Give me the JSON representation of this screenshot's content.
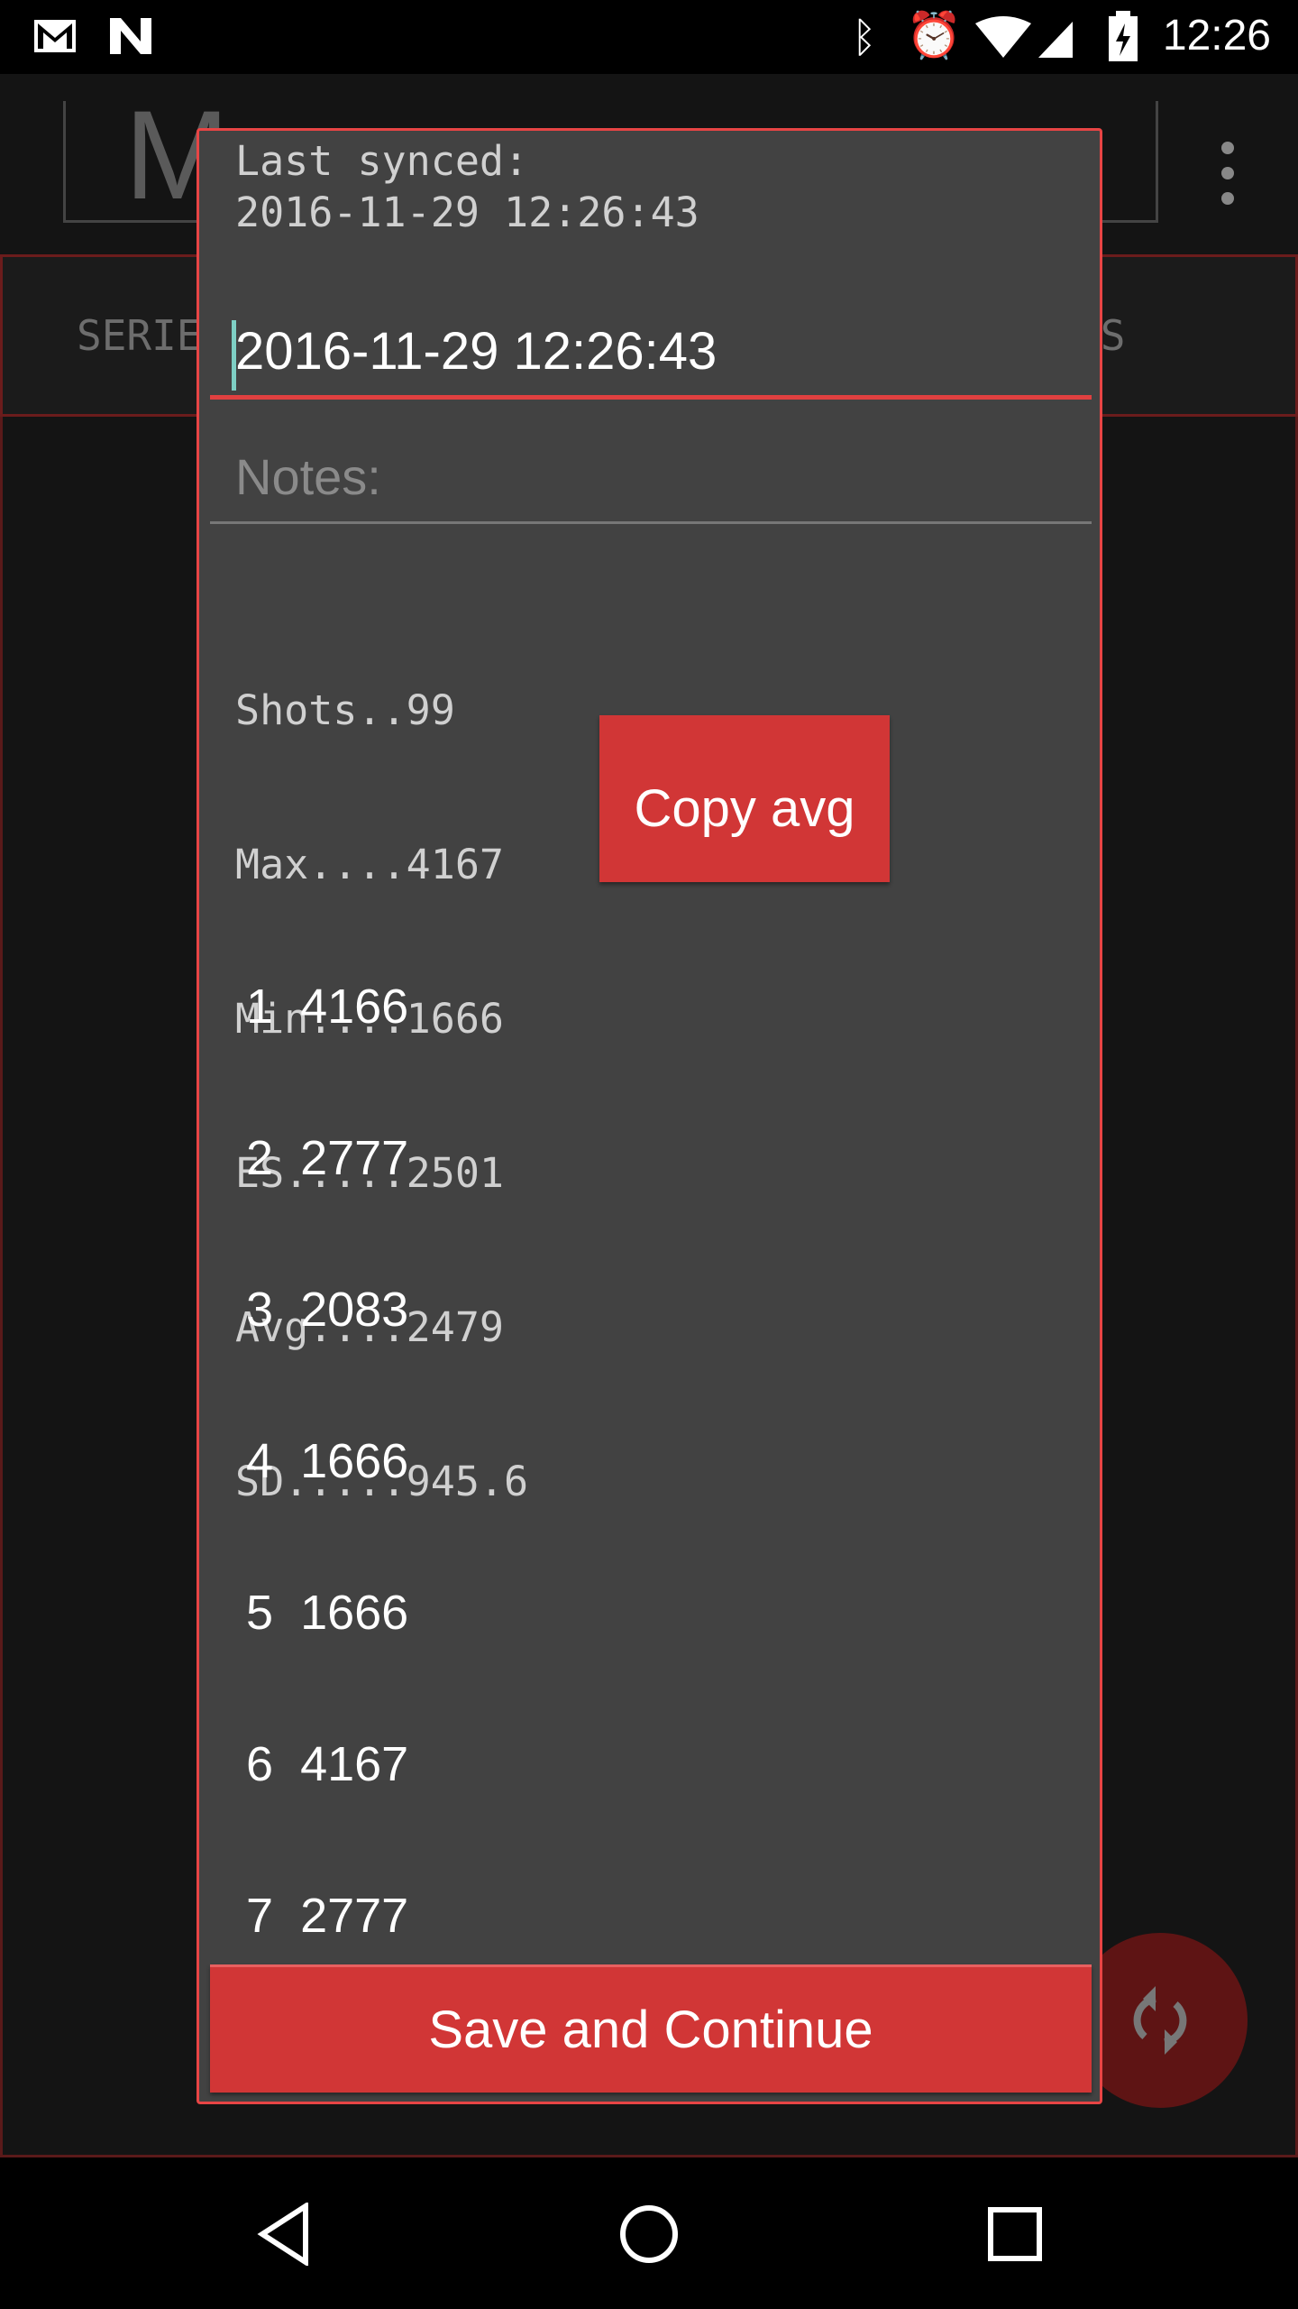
{
  "status_bar": {
    "time": "12:26",
    "icons": [
      "gmail-icon",
      "n-notification-icon",
      "bluetooth-icon",
      "alarm-icon",
      "wifi-icon",
      "signal-icon",
      "battery-charging-icon"
    ]
  },
  "app": {
    "logo_text": "M",
    "tabs": [
      "SERIE",
      "ES"
    ]
  },
  "dialog": {
    "last_synced_label": "Last synced:",
    "last_synced_value": "2016-11-29 12:26:43",
    "date_input_value": "2016-11-29 12:26:43",
    "notes_placeholder": "Notes:",
    "stats": [
      "Shots..99",
      "Max....4167",
      "Min....1666",
      "ES.....2501",
      "Avg....2479",
      "SD.....945.6"
    ],
    "copy_avg_label": "Copy avg",
    "shots": [
      {
        "n": "1",
        "v": "4166"
      },
      {
        "n": "2",
        "v": "2777"
      },
      {
        "n": "3",
        "v": "2083"
      },
      {
        "n": "4",
        "v": "1666"
      },
      {
        "n": "5",
        "v": "1666"
      },
      {
        "n": "6",
        "v": "4167"
      },
      {
        "n": "7",
        "v": "2777"
      }
    ],
    "save_label": "Save and Continue"
  },
  "colors": {
    "accent": "#d13636",
    "dialog_bg": "#424242",
    "border": "#e84545"
  }
}
